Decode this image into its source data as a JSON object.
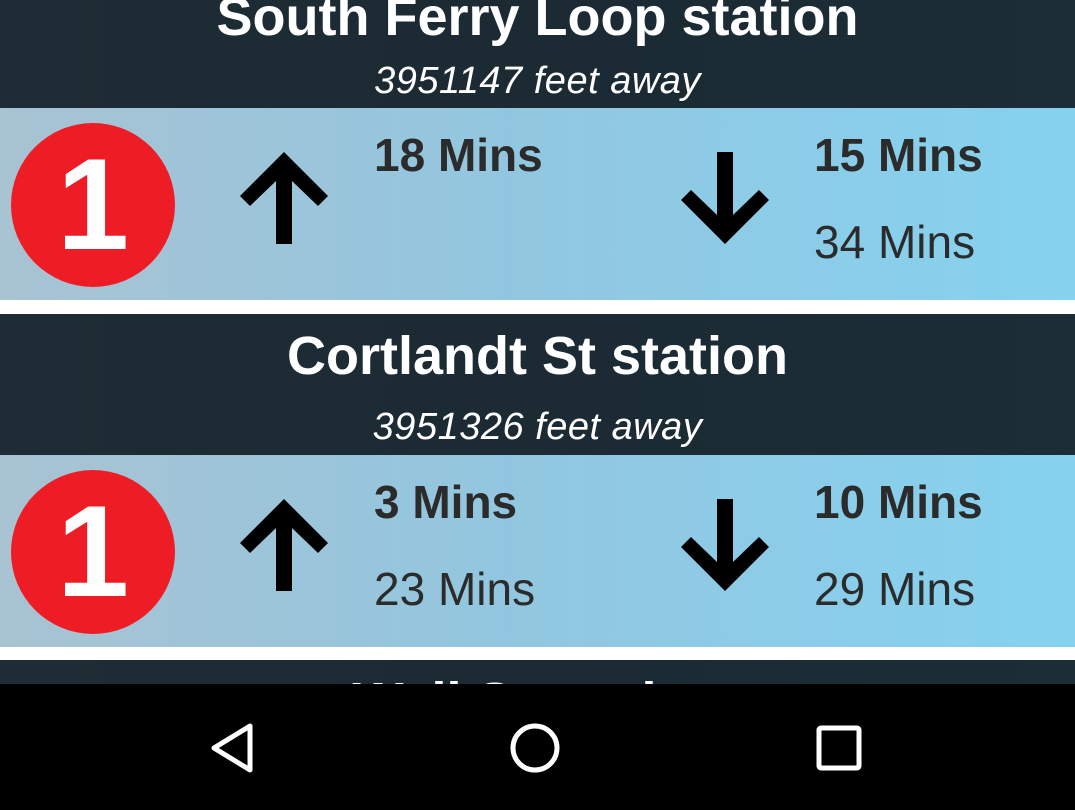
{
  "stations": [
    {
      "name": "South Ferry Loop station",
      "distance": "3951147 feet away",
      "route": {
        "label": "1",
        "color": "#ee1c25"
      },
      "uptown": {
        "first": "18 Mins",
        "second": ""
      },
      "downtown": {
        "first": "15 Mins",
        "second": "34 Mins"
      }
    },
    {
      "name": "Cortlandt St station",
      "distance": "3951326 feet away",
      "route": {
        "label": "1",
        "color": "#ee1c25"
      },
      "uptown": {
        "first": "3 Mins",
        "second": "23 Mins"
      },
      "downtown": {
        "first": "10 Mins",
        "second": "29 Mins"
      }
    },
    {
      "name": "Wall St station"
    }
  ],
  "icons": {
    "uptown": "arrow-up-icon",
    "downtown": "arrow-down-icon",
    "back": "back-triangle-icon",
    "home": "home-circle-icon",
    "recents": "recents-square-icon"
  }
}
